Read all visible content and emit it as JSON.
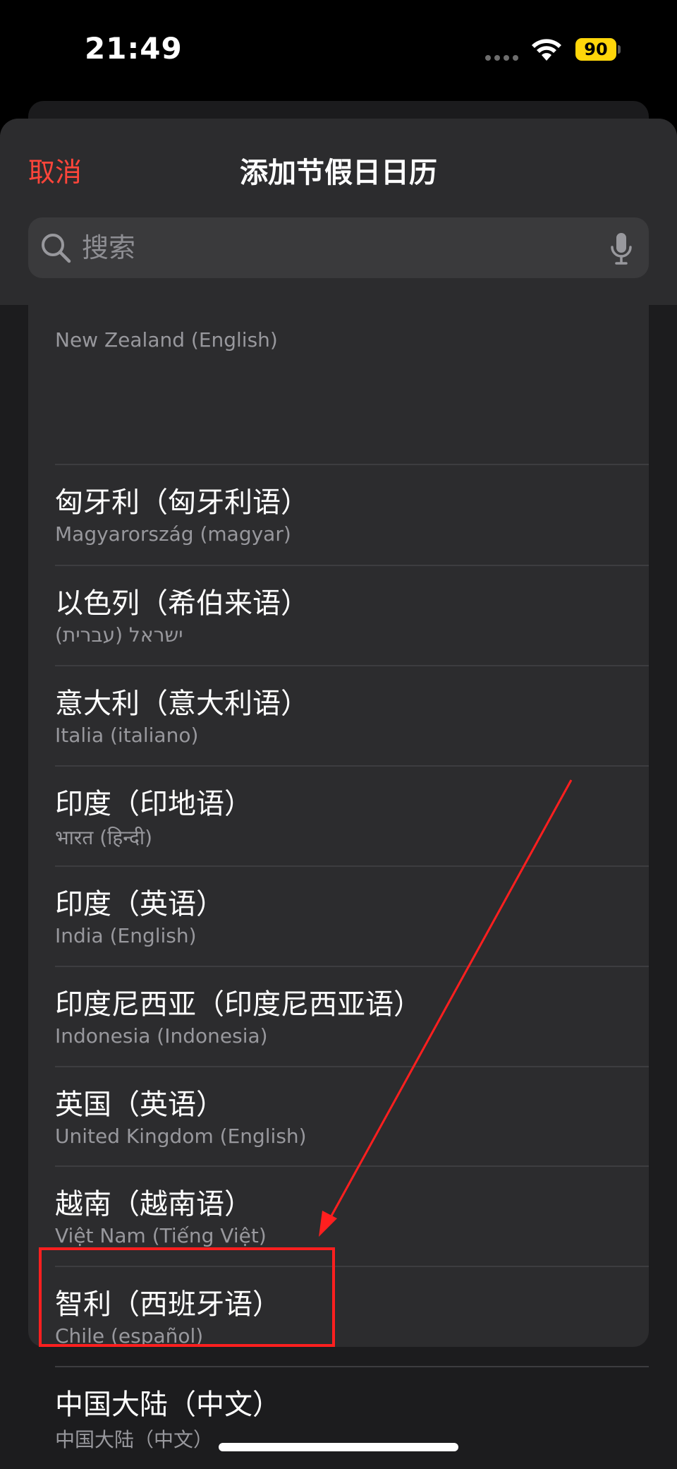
{
  "status_bar": {
    "time": "21:49",
    "battery": "90"
  },
  "header": {
    "cancel_label": "取消",
    "title": "添加节假日日历"
  },
  "search": {
    "placeholder": "搜索"
  },
  "list": {
    "items": [
      {
        "title": "",
        "subtitle": "New Zealand (English)"
      },
      {
        "title": "匈牙利（匈牙利语）",
        "subtitle": "Magyarország (magyar)"
      },
      {
        "title": "以色列（希伯来语）",
        "subtitle": "ישראל (עברית)"
      },
      {
        "title": "意大利（意大利语）",
        "subtitle": "Italia (italiano)"
      },
      {
        "title": "印度（印地语）",
        "subtitle": "भारत (हिन्दी)"
      },
      {
        "title": "印度（英语）",
        "subtitle": "India (English)"
      },
      {
        "title": "印度尼西亚（印度尼西亚语）",
        "subtitle": "Indonesia (Indonesia)"
      },
      {
        "title": "英国（英语）",
        "subtitle": "United Kingdom (English)"
      },
      {
        "title": "越南（越南语）",
        "subtitle": "Việt Nam (Tiếng Việt)"
      },
      {
        "title": "智利（西班牙语）",
        "subtitle": "Chile (español)"
      },
      {
        "title": "中国大陆（中文）",
        "subtitle": "中国大陆（中文）"
      }
    ]
  },
  "colors": {
    "accent": "#ff453a",
    "annotation": "#ff1f1f",
    "battery": "#ffd60a"
  }
}
